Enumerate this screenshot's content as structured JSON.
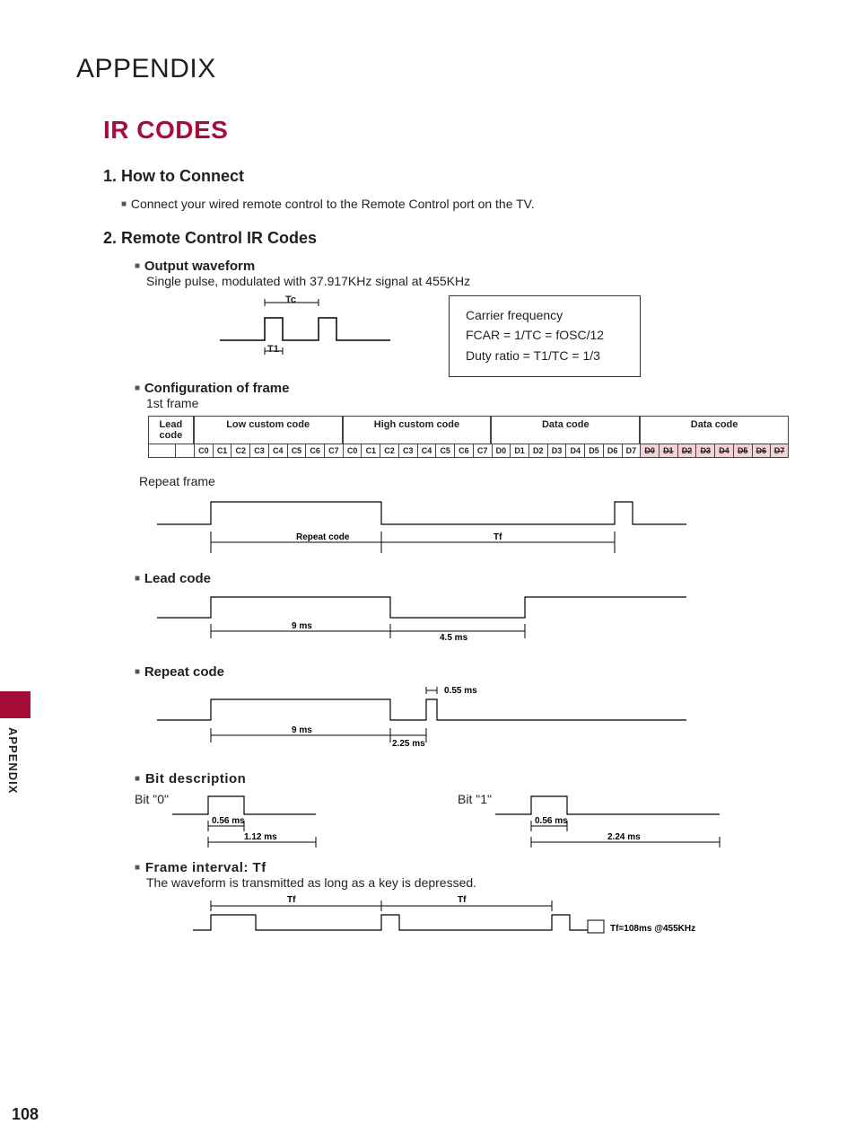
{
  "appendix_header": "APPENDIX",
  "title": "IR CODES",
  "section1": {
    "heading": "1. How to Connect",
    "text": "Connect your wired remote control to the Remote Control port on the TV."
  },
  "section2": {
    "heading": "2. Remote Control IR Codes",
    "output_waveform_label": "Output waveform",
    "output_waveform_text": "Single pulse, modulated with 37.917KHz signal at 455KHz",
    "tc": "Tc",
    "t1": "T1",
    "carrier_line1": "Carrier frequency",
    "carrier_line2": "FCAR = 1/TC = fOSC/12",
    "carrier_line3": "Duty ratio = T1/TC = 1/3",
    "config_label": "Configuration of frame",
    "first_frame": "1st frame",
    "headers": [
      "Lead code",
      "Low custom code",
      "High custom code",
      "Data code",
      "Data code"
    ],
    "low_bits": [
      "C0",
      "C1",
      "C2",
      "C3",
      "C4",
      "C5",
      "C6",
      "C7"
    ],
    "high_bits": [
      "C0",
      "C1",
      "C2",
      "C3",
      "C4",
      "C5",
      "C6",
      "C7"
    ],
    "data_bits": [
      "D0",
      "D1",
      "D2",
      "D3",
      "D4",
      "D5",
      "D6",
      "D7"
    ],
    "data_bits2": [
      "D0",
      "D1",
      "D2",
      "D3",
      "D4",
      "D5",
      "D6",
      "D7"
    ],
    "repeat_frame": "Repeat frame",
    "repeat_code_label": "Repeat code",
    "tf": "Tf",
    "lead_code_label": "Lead code",
    "nine_ms": "9 ms",
    "four_five_ms": "4.5 ms",
    "repeat_code_heading": "Repeat code",
    "zero_55": "0.55 ms",
    "two_25": "2.25 ms",
    "bit_desc_label": "Bit description",
    "bit0": "Bit \"0\"",
    "bit1": "Bit \"1\"",
    "ms_056": "0.56 ms",
    "ms_112": "1.12 ms",
    "ms_224": "2.24 ms",
    "frame_interval_label": "Frame interval: Tf",
    "frame_interval_text": "The waveform is transmitted as long as a key is depressed.",
    "tf_note": "Tf=108ms @455KHz"
  },
  "side_label": "APPENDIX",
  "page_number": "108"
}
